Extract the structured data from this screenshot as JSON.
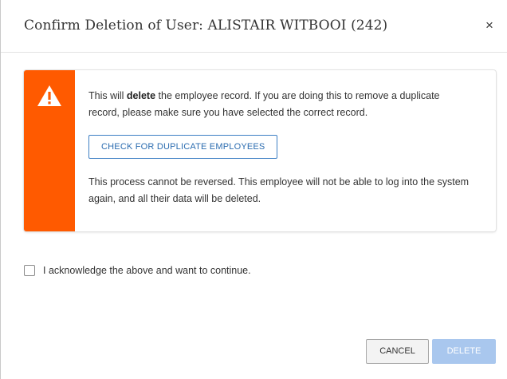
{
  "dialog": {
    "title": "Confirm Deletion of User: ALISTAIR WITBOOI (242)",
    "close_glyph": "×",
    "close_icon": "close-icon"
  },
  "alert": {
    "icon": "warning-icon",
    "strip_color": "#ff5a00",
    "paragraph1_pre": "This will ",
    "paragraph1_bold": "delete",
    "paragraph1_post": " the employee record. If you are doing this to remove a duplicate record, please make sure you have selected the correct record.",
    "check_button_label": "CHECK FOR DUPLICATE EMPLOYEES",
    "paragraph2": "This process cannot be reversed. This employee will not be able to log into the system again, and all their data will be deleted."
  },
  "acknowledge": {
    "checked": false,
    "label": "I acknowledge the above and want to continue."
  },
  "footer": {
    "cancel_label": "CANCEL",
    "delete_label": "DELETE",
    "delete_disabled": true,
    "delete_color": "#a9c7ee"
  }
}
